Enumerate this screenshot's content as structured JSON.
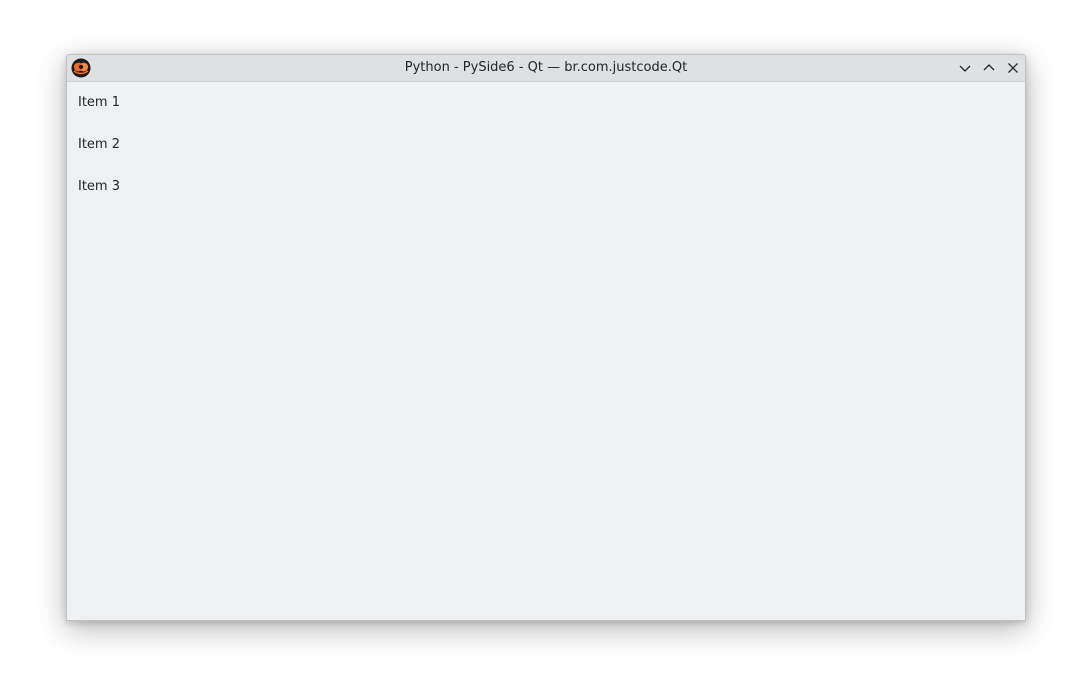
{
  "window": {
    "title": "Python - PySide6 - Qt — br.com.justcode.Qt",
    "app_icon": "python-app-icon",
    "controls": {
      "minimize_icon": "chevron-down-icon",
      "maximize_icon": "chevron-up-icon",
      "close_icon": "close-icon"
    }
  },
  "content": {
    "items": [
      {
        "label": "Item 1"
      },
      {
        "label": "Item 2"
      },
      {
        "label": "Item 3"
      }
    ]
  },
  "colors": {
    "titlebar": "#dee0e2",
    "window_background": "#eff0f1",
    "text": "#232629",
    "icon_orange": "#f26b1d"
  }
}
